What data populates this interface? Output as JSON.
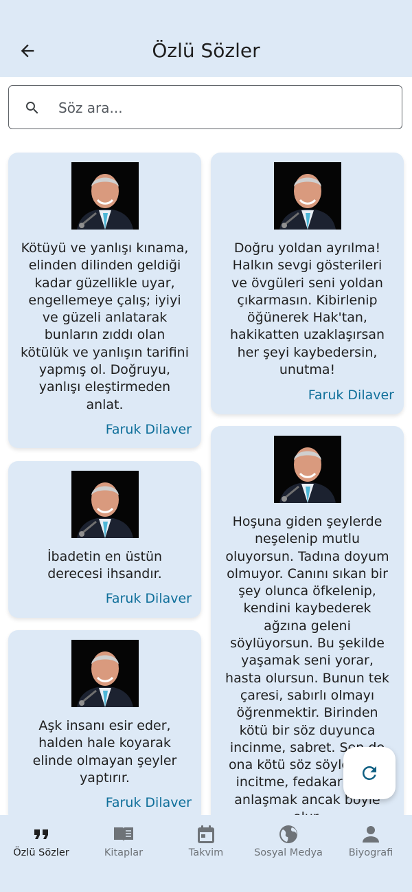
{
  "header": {
    "title": "Özlü Sözler"
  },
  "search": {
    "placeholder": "Söz ara..."
  },
  "quotes": [
    {
      "text": "Kötüyü ve yanlışı kınama, elinden dilinden geldiği kadar güzellikle uyar, engellemeye çalış; iyiyi ve güzeli anlatarak bunların zıddı olan kötülük ve yanlışın tarifini yapmış ol. Doğruyu, yanlışı eleştirmeden anlat.",
      "author": "Faruk Dilaver"
    },
    {
      "text": "Doğru yoldan ayrılma! Halkın sevgi gösterileri ve övgüleri seni yoldan çıkarmasın. Kibirlenip öğünerek Hak'tan, hakikatten uzaklaşırsan her şeyi kaybedersin, unutma!",
      "author": "Faruk Dilaver"
    },
    {
      "text": "İbadetin en üstün derecesi ihsandır.",
      "author": "Faruk Dilaver"
    },
    {
      "text": "Hoşuna giden şeylerde neşelenip mutlu oluyorsun. Tadına doyum olmuyor. Canını sıkan bir şey olunca öfkelenip, kendini kaybederek ağzına geleni söylüyorsun. Bu şekilde yaşamak seni yorar, hasta olursun. Bunun tek çaresi, sabırlı olmayı öğrenmektir. Birinden kötü bir söz duyunca incinme, sabret. Sen de ona kötü söz söyleyerek incitme, fedakarlık et, anlaşmak ancak böyle olur.",
      "author": "Faruk Dilaver"
    },
    {
      "text": "Aşk insanı esir eder, halden hale koyarak elinde olmayan şeyler yaptırır.",
      "author": "Faruk Dilaver"
    }
  ],
  "colors": {
    "surface": "#dde9f6",
    "accent": "#0f6f9a",
    "text": "#1f1f1f",
    "inactive": "#6e7378"
  },
  "icons": {
    "back": "arrow-back-icon",
    "search": "search-icon",
    "refresh": "refresh-icon"
  },
  "nav": {
    "items": [
      {
        "label": "Özlü Sözler",
        "icon": "quote-icon",
        "active": true
      },
      {
        "label": "Kitaplar",
        "icon": "book-icon",
        "active": false
      },
      {
        "label": "Takvim",
        "icon": "calendar-icon",
        "active": false
      },
      {
        "label": "Sosyal Medya",
        "icon": "globe-icon",
        "active": false
      },
      {
        "label": "Biyografi",
        "icon": "person-icon",
        "active": false
      }
    ]
  }
}
